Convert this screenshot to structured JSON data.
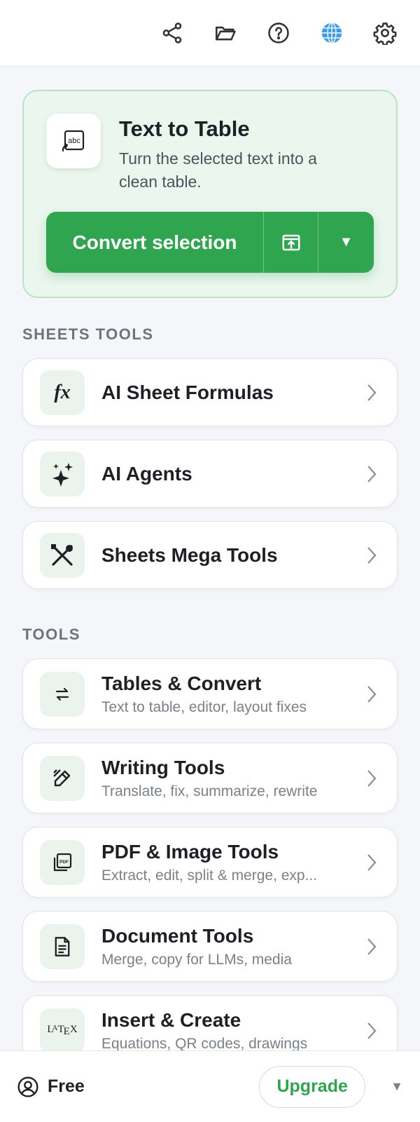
{
  "toolbar": {
    "icons": [
      "share-icon",
      "folder-icon",
      "help-icon",
      "globe-icon",
      "gear-icon"
    ]
  },
  "hero": {
    "icon": "text-to-table-icon",
    "title": "Text to Table",
    "description": "Turn the selected text into a clean table.",
    "convert_label": "Convert selection",
    "export_icon": "export-icon",
    "dropdown_icon": "caret-down-icon"
  },
  "sheets_tools": {
    "label": "SHEETS TOOLS",
    "items": [
      {
        "title": "AI Sheet Formulas",
        "icon": "fx-icon"
      },
      {
        "title": "AI Agents",
        "icon": "sparkle-icon"
      },
      {
        "title": "Sheets Mega Tools",
        "icon": "tools-icon"
      }
    ]
  },
  "tools": {
    "label": "TOOLS",
    "items": [
      {
        "title": "Tables & Convert",
        "subtitle": "Text to table, editor, layout fixes",
        "icon": "swap-arrows-icon"
      },
      {
        "title": "Writing Tools",
        "subtitle": "Translate, fix, summarize, rewrite",
        "icon": "pen-icon"
      },
      {
        "title": "PDF & Image Tools",
        "subtitle": "Extract, edit, split & merge, exp...",
        "icon": "pdf-icon"
      },
      {
        "title": "Document Tools",
        "subtitle": "Merge, copy for LLMs, media",
        "icon": "document-icon"
      },
      {
        "title": "Insert & Create",
        "subtitle": "Equations, QR codes, drawings",
        "icon": "latex-icon"
      }
    ]
  },
  "footer": {
    "plan": "Free",
    "upgrade_label": "Upgrade"
  },
  "colors": {
    "accent": "#2fa54f",
    "hero_bg": "#eaf6ee",
    "page_bg": "#f4f6f9"
  }
}
